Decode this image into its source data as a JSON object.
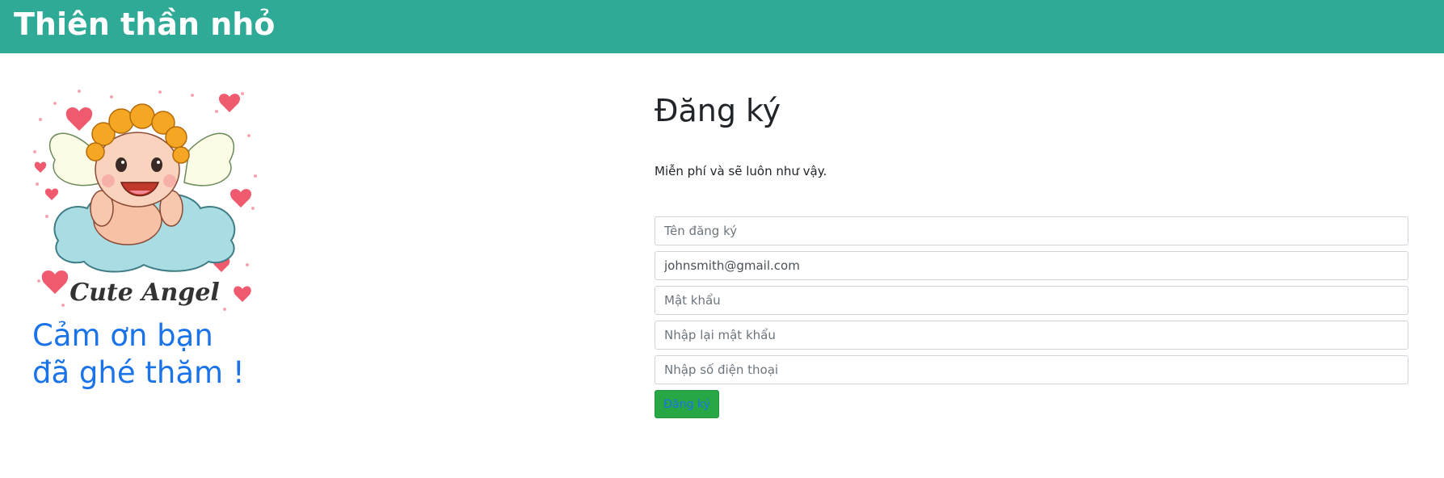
{
  "header": {
    "title": "Thiên thần nhỏ"
  },
  "left": {
    "image": {
      "icon": "cute-angel-illustration",
      "caption": "Cute Angel"
    },
    "thanks_line1": "Cảm ơn bạn",
    "thanks_line2": "đã ghé thăm !"
  },
  "form": {
    "title": "Đăng ký",
    "subtitle": "Miễn phí và sẽ luôn như vậy.",
    "fields": [
      {
        "name": "username",
        "placeholder": "Tên đăng ký",
        "value": ""
      },
      {
        "name": "email",
        "placeholder": "",
        "value": "johnsmith@gmail.com"
      },
      {
        "name": "password",
        "placeholder": "Mật khẩu",
        "value": ""
      },
      {
        "name": "password-confirm",
        "placeholder": "Nhập lại mật khẩu",
        "value": ""
      },
      {
        "name": "phone",
        "placeholder": "Nhập số điện thoại",
        "value": ""
      }
    ],
    "submit_label": "Đăng ký"
  },
  "colors": {
    "header_bg": "#2eaa96",
    "thanks_text": "#1a73e8",
    "submit_bg": "#28a745"
  }
}
